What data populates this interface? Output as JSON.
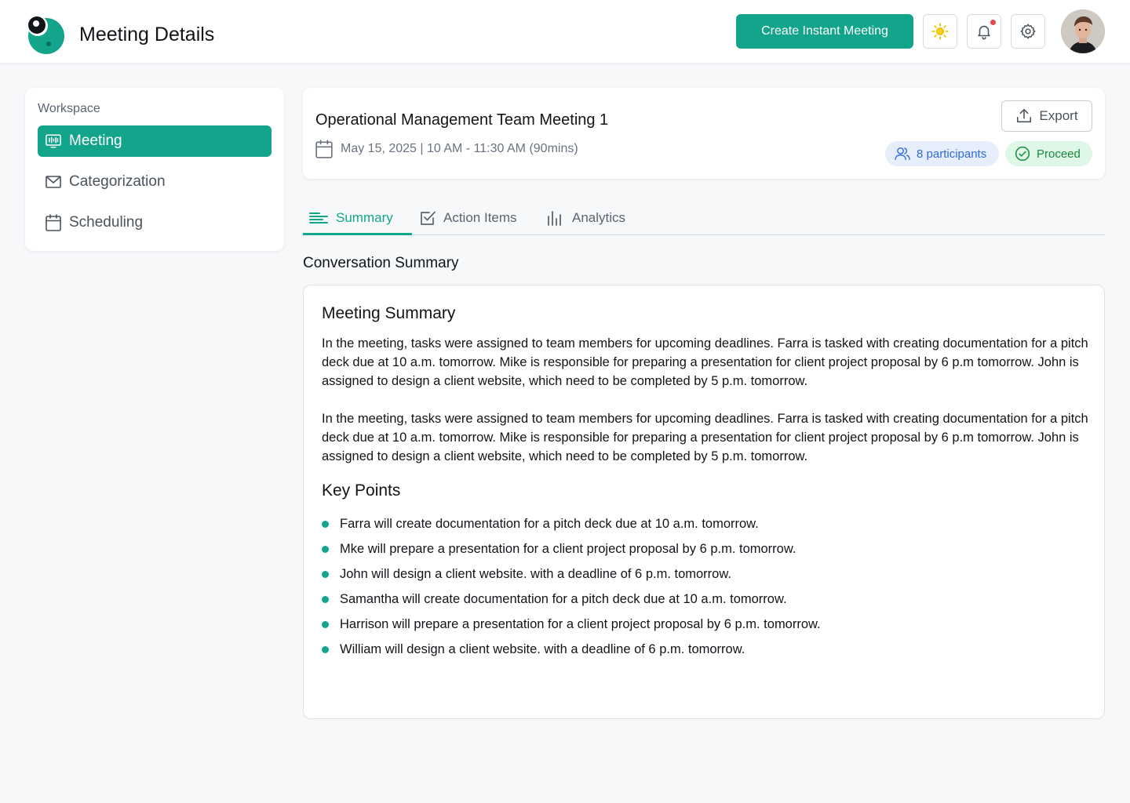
{
  "header": {
    "title": "Meeting Details",
    "create_button": "Create Instant Meeting",
    "icons": [
      "sun-icon",
      "bell-icon",
      "gear-icon"
    ],
    "has_notification": true
  },
  "sidebar": {
    "heading": "Workspace",
    "items": [
      {
        "label": "Meeting",
        "icon": "meeting-icon",
        "active": true
      },
      {
        "label": "Categorization",
        "icon": "mail-icon",
        "active": false
      },
      {
        "label": "Scheduling",
        "icon": "calendar-icon",
        "active": false
      }
    ]
  },
  "meeting": {
    "title": "Operational Management Team Meeting 1",
    "date": "May 15, 2025 | 10 AM - 11:30 AM (90mins)",
    "export_label": "Export",
    "participants": "8 participants",
    "status": "Proceed"
  },
  "tabs": [
    {
      "label": "Summary",
      "icon": "lines-icon",
      "active": true
    },
    {
      "label": "Action Items",
      "icon": "checkbox-icon",
      "active": false
    },
    {
      "label": "Analytics",
      "icon": "bar-chart-icon",
      "active": false
    }
  ],
  "content": {
    "section_title": "Conversation Summary",
    "summary_heading": "Meeting Summary",
    "paragraphs": [
      "In the meeting, tasks were assigned to team members for upcoming deadlines. Farra is tasked with creating documentation for a pitch deck due at 10 a.m. tomorrow. Mike is responsible for preparing a presentation for client project proposal by 6 p.m tomorrow. John is assigned to design a client website, which need to be completed by 5 p.m. tomorrow.",
      "In the meeting, tasks were assigned to team members for upcoming deadlines. Farra is tasked with creating documentation for a pitch deck due at 10 a.m. tomorrow. Mike is responsible for preparing a presentation for client project proposal by 6 p.m tomorrow. John is assigned to design a client website, which need to be completed by 5 p.m. tomorrow."
    ],
    "key_points_heading": "Key Points",
    "key_points": [
      "Farra will create documentation for a pitch deck due at 10 a.m. tomorrow.",
      "Mke will prepare a presentation for a client project proposal by 6 p.m. tomorrow.",
      "John will design a client website. with a deadline of 6 p.m. tomorrow.",
      "Samantha will create documentation for a pitch deck due at 10 a.m. tomorrow.",
      "Harrison will prepare a presentation for a client project proposal by 6 p.m. tomorrow.",
      "William will design a client website. with a deadline of 6 p.m. tomorrow."
    ]
  },
  "colors": {
    "accent": "#13a58c",
    "participants_bg": "#e6eefc",
    "participants_fg": "#2f6ad9",
    "status_bg": "#def7e6",
    "status_fg": "#168a3c",
    "notification": "#e5484d"
  }
}
